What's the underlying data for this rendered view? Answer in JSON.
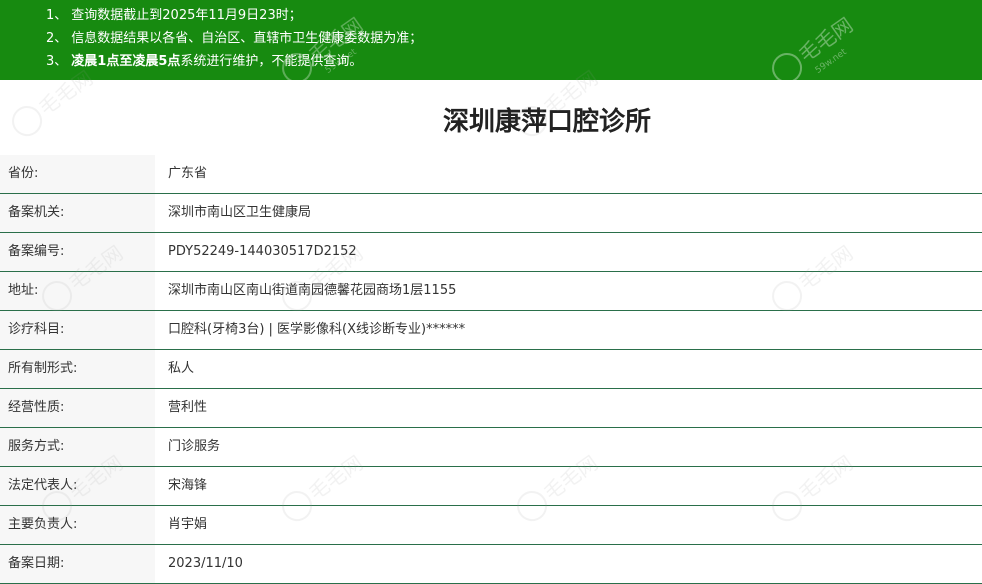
{
  "notice": {
    "line1_num": "1、",
    "line1_text": "查询数据截止到2025年11月9日23时；",
    "line2_num": "2、",
    "line2_text": "信息数据结果以各省、自治区、直辖市卫生健康委数据为准；",
    "line3_num": "3、",
    "line3_bold": "凌晨1点至凌晨5点",
    "line3_text": "系统进行维护，不能提供查询。"
  },
  "title": "深圳康萍口腔诊所",
  "rows": [
    {
      "label": "省份:",
      "value": "广东省"
    },
    {
      "label": "备案机关:",
      "value": "深圳市南山区卫生健康局"
    },
    {
      "label": "备案编号:",
      "value": "PDY52249-144030517D2152"
    },
    {
      "label": "地址:",
      "value": "深圳市南山区南山街道南园德馨花园商场1层1155"
    },
    {
      "label": "诊疗科目:",
      "value": "口腔科(牙椅3台) | 医学影像科(X线诊断专业)******"
    },
    {
      "label": "所有制形式:",
      "value": "私人"
    },
    {
      "label": "经营性质:",
      "value": "营利性"
    },
    {
      "label": "服务方式:",
      "value": "门诊服务"
    },
    {
      "label": "法定代表人:",
      "value": "宋海锋"
    },
    {
      "label": "主要负责人:",
      "value": "肖宇娟"
    },
    {
      "label": "备案日期:",
      "value": "2023/11/10"
    }
  ],
  "watermark": {
    "text": "毛毛网",
    "url_text": "59w.net"
  }
}
